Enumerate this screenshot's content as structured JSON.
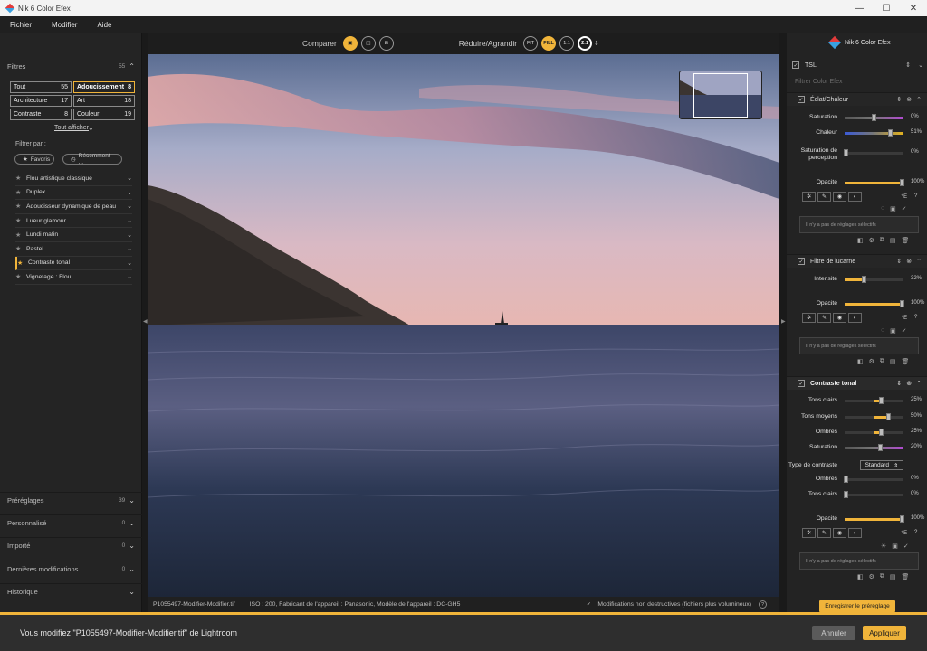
{
  "window": {
    "title": "Nik 6 Color Efex",
    "minimize": "—",
    "maximize": "☐",
    "close": "✕"
  },
  "menu": [
    "Fichier",
    "Modifier",
    "Aide"
  ],
  "left": {
    "filters_head": "Filtres",
    "filters_count": "55",
    "categories": [
      {
        "label": "Tout",
        "count": "55"
      },
      {
        "label": "Adoucissement",
        "count": "8"
      },
      {
        "label": "Architecture",
        "count": "17"
      },
      {
        "label": "Art",
        "count": "18"
      },
      {
        "label": "Contraste",
        "count": "8"
      },
      {
        "label": "Couleur",
        "count": "19"
      }
    ],
    "show_all": "Tout afficher",
    "filter_by": "Filtrer par :",
    "favorites": "Favoris",
    "recent": "Récemment ...",
    "filters": [
      "Flou artistique classique",
      "Duplex",
      "Adoucisseur dynamique de peau",
      "Lueur glamour",
      "Lundi matin",
      "Pastel",
      "Contraste tonal",
      "Vignetage : Flou"
    ],
    "bottom_sections": [
      {
        "label": "Préréglages",
        "count": "39"
      },
      {
        "label": "Personnalisé",
        "count": "0"
      },
      {
        "label": "Importé",
        "count": "0"
      },
      {
        "label": "Dernières modifications",
        "count": "0"
      },
      {
        "label": "Historique",
        "count": ""
      }
    ]
  },
  "toolbar": {
    "compare": "Comparer",
    "resize": "Réduire/Agrandir",
    "fit": "FIT",
    "fill": "FILL",
    "one": "1:1",
    "two": "2:1"
  },
  "status": {
    "filename": "P1055497-Modifier-Modifier.tif",
    "meta": "ISO : 200, Fabricant de l'appareil : Panasonic, Modèle de l'appareil : DC-GH5",
    "nondestructive": "Modifications non destructives (fichiers plus volumineux)"
  },
  "right": {
    "brand": "Nik 6 Color Efex",
    "tsl": "TSL",
    "search_placeholder": "Filtrer Color Efex",
    "no_selective": "Il n'y a pas de réglages sélectifs",
    "sections": {
      "eclat": {
        "title": "Éclat/Chaleur",
        "sliders": [
          {
            "label": "Saturation",
            "value": "0%"
          },
          {
            "label": "Chaleur",
            "value": "51%"
          },
          {
            "label": "Saturation de perception",
            "value": "0%"
          }
        ],
        "opacity_label": "Opacité",
        "opacity_value": "100%"
      },
      "lucarne": {
        "title": "Filtre de lucarne",
        "sliders": [
          {
            "label": "Intensité",
            "value": "32%"
          }
        ],
        "opacity_label": "Opacité",
        "opacity_value": "100%"
      },
      "contraste": {
        "title": "Contraste tonal",
        "sliders": [
          {
            "label": "Tons clairs",
            "value": "25%"
          },
          {
            "label": "Tons moyens",
            "value": "50%"
          },
          {
            "label": "Ombres",
            "value": "25%"
          },
          {
            "label": "Saturation",
            "value": "20%"
          }
        ],
        "type_label": "Type de contraste",
        "type_value": "Standard",
        "sliders2": [
          {
            "label": "Ombres",
            "value": "0%"
          },
          {
            "label": "Tons clairs",
            "value": "0%"
          }
        ],
        "opacity_label": "Opacité",
        "opacity_value": "100%"
      }
    },
    "save_preset": "Enregistrer le préréglage"
  },
  "bottom": {
    "message": "Vous modifiez \"P1055497-Modifier-Modifier.tif\" de Lightroom",
    "cancel": "Annuler",
    "apply": "Appliquer"
  },
  "colors": {
    "accent": "#f0b43a"
  }
}
